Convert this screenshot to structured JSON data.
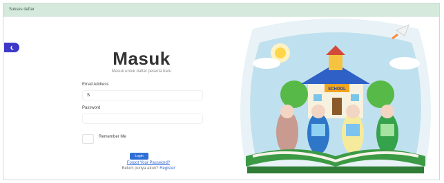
{
  "alert": {
    "message": "Sukses daftar"
  },
  "theme_toggle": {
    "icon": "moon-icon"
  },
  "login": {
    "title": "Masuk",
    "subtitle": "Masuk untuk daftar peserta baru",
    "email_label": "Email Address",
    "email_value": "S",
    "password_label": "Password",
    "password_value": "",
    "remember_label": "Remember Me",
    "login_button": "Login",
    "forgot_link": "Forgot Your Password?",
    "register_prompt": "Belum punya akun?",
    "register_link": "Register"
  },
  "illustration": {
    "school_sign": "SCHOOL"
  },
  "colors": {
    "alert_bg": "#d5eadd",
    "primary": "#2f6fd6",
    "toggle": "#3d38c9"
  }
}
